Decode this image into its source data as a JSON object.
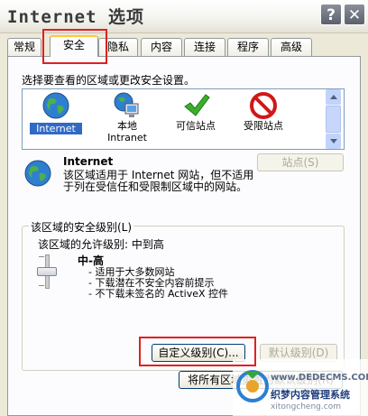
{
  "window": {
    "title": "Internet 选项",
    "help_label": "?",
    "close_label": "✕"
  },
  "tabs": [
    {
      "label": "常规"
    },
    {
      "label": "安全"
    },
    {
      "label": "隐私"
    },
    {
      "label": "内容"
    },
    {
      "label": "连接"
    },
    {
      "label": "程序"
    },
    {
      "label": "高级"
    }
  ],
  "security": {
    "zone_prompt": "选择要查看的区域或更改安全设置。",
    "zones": [
      {
        "label": "Internet",
        "icon": "globe-icon",
        "selected": true
      },
      {
        "label": "本地\nIntranet",
        "icon": "intranet-icon"
      },
      {
        "label": "可信站点",
        "icon": "checkmark-icon"
      },
      {
        "label": "受限站点",
        "icon": "prohibited-icon"
      }
    ],
    "selected_zone": {
      "title": "Internet",
      "description": "该区域适用于 Internet 网站，但不适用于列在受信任和受限制区域中的网站。",
      "sites_button": "站点(S)"
    },
    "level_group": {
      "label": "该区域的安全级别(L)",
      "allowed_levels": "该区域的允许级别: 中到高",
      "level_name": "中-高",
      "items": [
        "- 适用于大多数网站",
        "- 下载潜在不安全内容前提示",
        "- 不下载未签名的 ActiveX 控件"
      ]
    },
    "custom_level_button": "自定义级别(C)...",
    "default_level_button": "默认级别(D)",
    "reset_all_button": "将所有区域重置为默认级别(R)"
  },
  "watermark": {
    "site": "www.DEDECMS.COM",
    "name": "织梦内容管理系统",
    "domain": "xitongcheng.com"
  },
  "colors": {
    "highlight_red": "#e02020",
    "selection_blue": "#316ac5",
    "dialog_bg": "#ece9d8"
  }
}
